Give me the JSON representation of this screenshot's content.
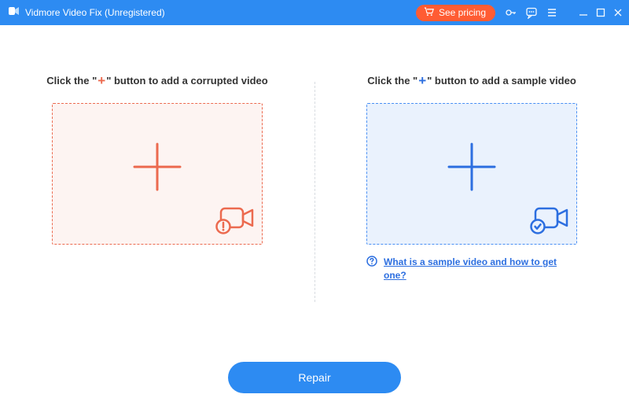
{
  "titlebar": {
    "title": "Vidmore Video Fix (Unregistered)",
    "pricing_label": "See pricing"
  },
  "icons": {
    "logo": "app-logo",
    "cart": "cart-icon",
    "key": "key-icon",
    "feedback": "feedback-icon",
    "menu": "menu-icon",
    "minimize": "minimize-icon",
    "maximize": "maximize-icon",
    "close": "close-icon"
  },
  "panels": {
    "left": {
      "hdr_a": "Click the \"",
      "hdr_plus": "+",
      "hdr_b": "\" button to add a corrupted video"
    },
    "right": {
      "hdr_a": "Click the \"",
      "hdr_plus": "+",
      "hdr_b": "\" button to add a sample video",
      "help_text": "What is a sample video and how to get one?"
    }
  },
  "footer": {
    "repair_label": "Repair"
  },
  "colors": {
    "titlebar": "#2d8bf2",
    "pricing": "#ff5c33",
    "red_accent": "#ec6a4f",
    "blue_accent": "#2d6fe0"
  }
}
